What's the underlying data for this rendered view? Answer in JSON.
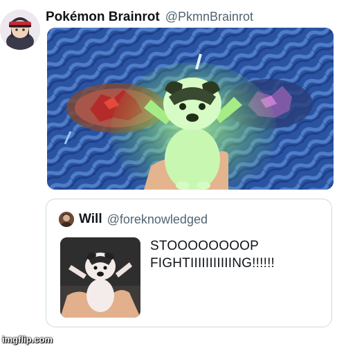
{
  "post": {
    "display_name": "Pokémon Brainrot",
    "handle": "@PkmnBrainrot",
    "avatar_icon": "trainer-avatar-icon",
    "media_description_icon": "pokemon-battle-with-puppy-image"
  },
  "quote": {
    "display_name": "Will",
    "handle": "@foreknowledged",
    "avatar_icon": "user-avatar-icon",
    "text": "STOOOOOOOOP\nFIGHTIIIIIIIIIIING!!!!!!",
    "thumbnail_icon": "puppy-photo-icon"
  },
  "watermark": "imgflip.com",
  "colors": {
    "name": "#0f1419",
    "handle": "#536471",
    "border": "#cfd9de",
    "water": "#2a53a2"
  }
}
